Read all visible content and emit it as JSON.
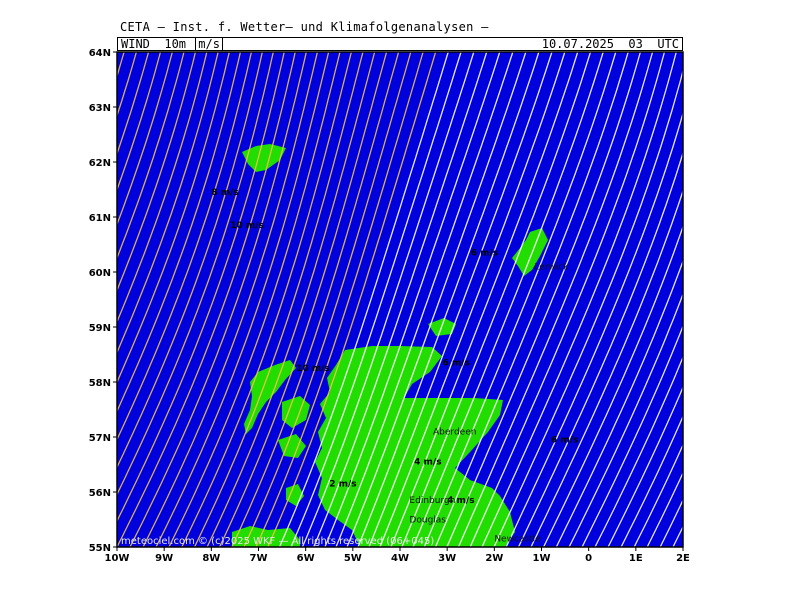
{
  "header": {
    "title": "CETA — Inst. f. Wetter— und Klimafolgenanalysen —",
    "field_name": "WIND  10m",
    "unit": "m/s",
    "valid_time": "10.07.2025  03  UTC"
  },
  "colors": {
    "sea": "#0000dd",
    "land": "#22dd00",
    "streamline_strong": "#f2c24a",
    "streamline_weak": "#ffffff",
    "frame": "#000000"
  },
  "map": {
    "lon_range": [
      -10,
      2
    ],
    "lat_range": [
      55,
      64
    ],
    "lat_ticks": [
      "55N",
      "56N",
      "57N",
      "58N",
      "59N",
      "60N",
      "61N",
      "62N",
      "63N",
      "64N"
    ],
    "lon_ticks": [
      "10W",
      "9W",
      "8W",
      "7W",
      "6W",
      "5W",
      "4W",
      "3W",
      "2W",
      "1W",
      "0",
      "1E",
      "2E"
    ],
    "speed_labels": [
      {
        "text": "8 m/s",
        "lon": -8.0,
        "lat": 61.4
      },
      {
        "text": "10 m/s",
        "lon": -7.6,
        "lat": 60.8
      },
      {
        "text": "6 m/s",
        "lon": -2.5,
        "lat": 60.3
      },
      {
        "text": "10 m/s",
        "lon": -6.2,
        "lat": 58.2
      },
      {
        "text": "6 m/s",
        "lon": -3.1,
        "lat": 58.3
      },
      {
        "text": "6 m/s",
        "lon": -0.8,
        "lat": 56.9
      },
      {
        "text": "4 m/s",
        "lon": -3.7,
        "lat": 56.5
      },
      {
        "text": "2 m/s",
        "lon": -5.5,
        "lat": 56.1
      },
      {
        "text": "4 m/s",
        "lon": -3.0,
        "lat": 55.8
      }
    ],
    "place_labels": [
      {
        "text": "Aberdeen",
        "lon": -3.3,
        "lat": 57.05
      },
      {
        "text": "Edinburgh",
        "lon": -3.8,
        "lat": 55.8
      },
      {
        "text": "Douglas",
        "lon": -3.8,
        "lat": 55.45
      },
      {
        "text": "Lerwick",
        "lon": -1.15,
        "lat": 60.05
      },
      {
        "text": "Newcastle",
        "lon": -2.0,
        "lat": 55.1
      }
    ],
    "copyright": "meteociel.com © (c)2025 WKF — All rights reserved (06+045)"
  }
}
